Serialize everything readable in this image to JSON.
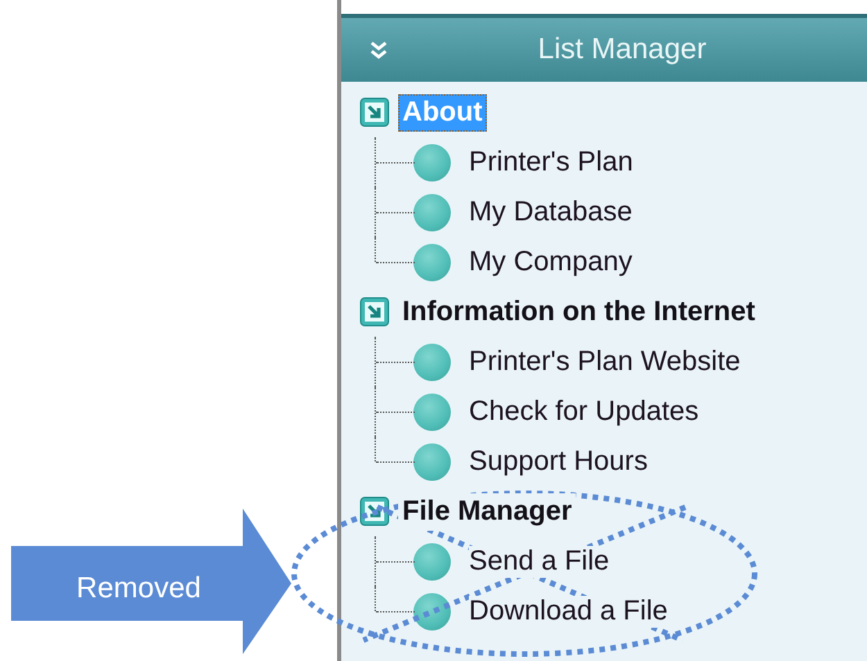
{
  "panel": {
    "title": "List Manager"
  },
  "groups": [
    {
      "label": "About",
      "selected": true,
      "children": [
        {
          "label": "Printer's Plan"
        },
        {
          "label": "My Database"
        },
        {
          "label": "My Company"
        }
      ]
    },
    {
      "label": "Information on the Internet",
      "selected": false,
      "children": [
        {
          "label": "Printer's Plan Website"
        },
        {
          "label": "Check for Updates"
        },
        {
          "label": "Support Hours"
        }
      ]
    },
    {
      "label": "File Manager",
      "selected": false,
      "children": [
        {
          "label": "Send a File"
        },
        {
          "label": "Download a File"
        }
      ]
    }
  ],
  "annotation": {
    "label": "Removed"
  }
}
